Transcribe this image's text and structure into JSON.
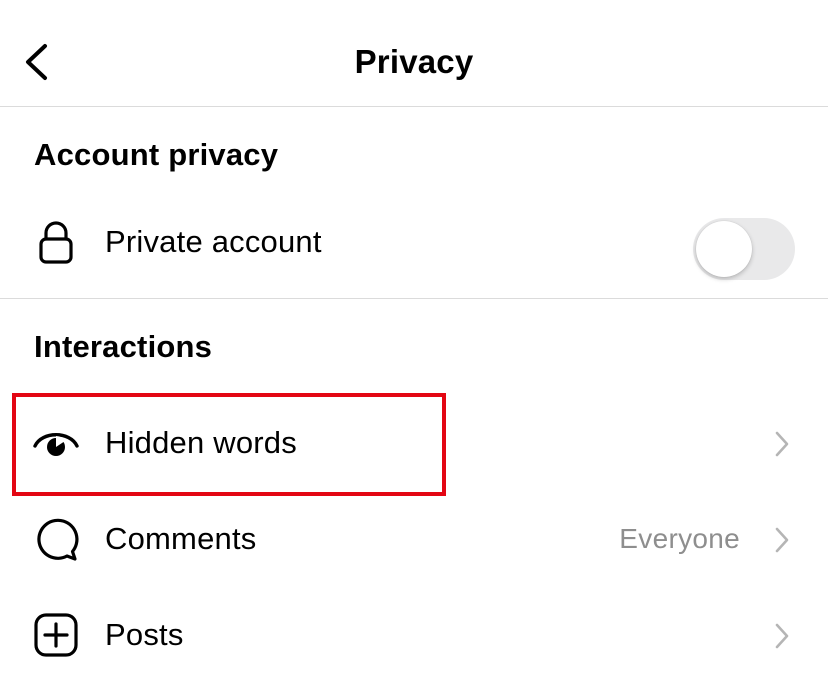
{
  "header": {
    "title": "Privacy"
  },
  "sections": {
    "account_privacy": {
      "title": "Account privacy",
      "private_account": {
        "label": "Private account",
        "toggle_on": false
      }
    },
    "interactions": {
      "title": "Interactions",
      "items": [
        {
          "label": "Hidden words",
          "value": "",
          "icon": "eye-icon"
        },
        {
          "label": "Comments",
          "value": "Everyone",
          "icon": "comment-bubble-icon"
        },
        {
          "label": "Posts",
          "value": "",
          "icon": "plus-square-icon"
        }
      ]
    }
  },
  "colors": {
    "highlight_box": "#e30613",
    "divider": "#dbdbdb",
    "secondary_text": "#8e8e8e",
    "toggle_off_track": "#e9e9ea"
  }
}
